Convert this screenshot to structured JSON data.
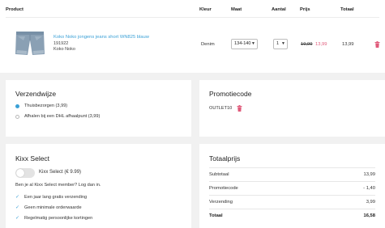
{
  "table": {
    "headers": {
      "product": "Product",
      "kleur": "Kleur",
      "maat": "Maat",
      "aantal": "Aantal",
      "prijs": "Prijs",
      "totaal": "Totaal"
    },
    "item": {
      "name": "Koko Noko jongens jeans short WN825 blauw",
      "sku": "191922",
      "brand": "Koko Noko",
      "colour": "Denim",
      "size": "134-140",
      "quantity": "1",
      "old_price": "19,99",
      "new_price": "13,99",
      "total": "13,99"
    }
  },
  "shipping": {
    "title": "Verzendwijze",
    "options": [
      {
        "label": "Thuisbezorgen (3,99)",
        "selected": true
      },
      {
        "label": "Afhalen bij een DHL afhaalpunt (3,99)",
        "selected": false
      }
    ]
  },
  "promo": {
    "title": "Promotiecode",
    "code": "OUTLET10"
  },
  "kixx": {
    "title": "Kixx Select",
    "toggle_label": "Kixx Select (€ 9.99)",
    "toggle_on": false,
    "member_text": "Ben je al Kixx Select member? Log dan in.",
    "benefits": [
      "Een jaar lang gratis verzending",
      "Geen minimale orderwaarde",
      "Regelmatig persoonlijke kortingen"
    ]
  },
  "totals": {
    "title": "Totaalprijs",
    "rows": [
      {
        "label": "Subtotaal",
        "value": "13,99"
      },
      {
        "label": "Promotiecode",
        "value": "- 1,40"
      },
      {
        "label": "Verzending",
        "value": "3,99"
      },
      {
        "label": "Totaal",
        "value": "16,58"
      }
    ]
  },
  "colors": {
    "accent": "#3aa0d6",
    "sale": "#e05a7a",
    "delete": "#e05a7a",
    "background": "#f1f1f1",
    "card": "#ffffff"
  },
  "icons": [
    "product-thumbnail",
    "chevron-down-icon",
    "trash-icon",
    "check-icon"
  ]
}
